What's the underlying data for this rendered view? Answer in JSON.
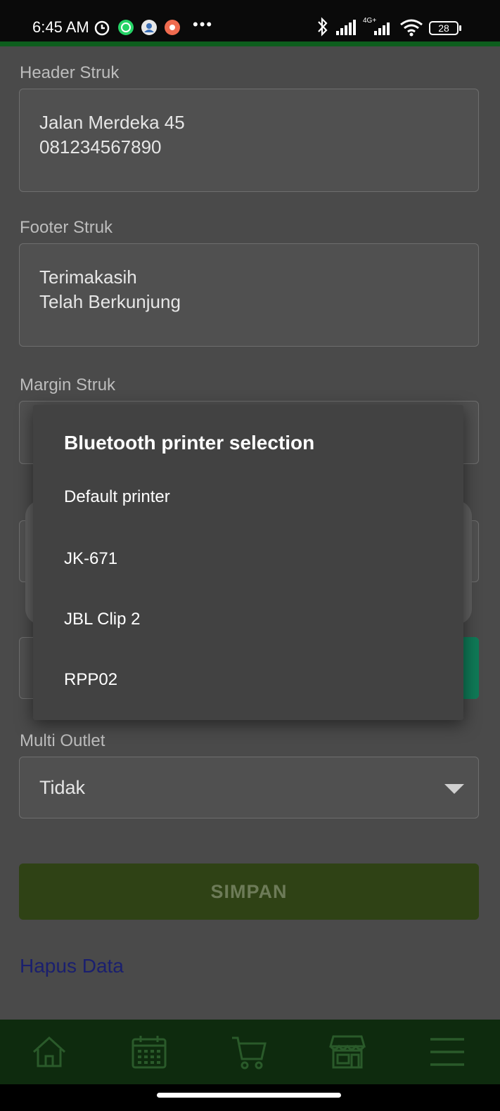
{
  "status_bar": {
    "time": "6:45 AM",
    "battery": "28",
    "network": "4G+",
    "icons": [
      "alarm-icon",
      "whatsapp-icon",
      "contacts-icon",
      "notification-app-icon",
      "bluetooth-icon",
      "signal-icon",
      "wifi-icon",
      "battery-icon"
    ]
  },
  "form": {
    "header_label": "Header Struk",
    "header_value": "Jalan Merdeka 45\n081234567890",
    "footer_label": "Footer Struk",
    "footer_value": "Terimakasih\nTelah Berkunjung",
    "margin_label": "Margin Struk",
    "multi_outlet_label": "Multi Outlet",
    "multi_outlet_value": "Tidak",
    "save_label": "SIMPAN",
    "delete_link": "Hapus Data"
  },
  "dialog": {
    "title": "Bluetooth printer selection",
    "items": [
      {
        "label": "Default printer"
      },
      {
        "label": "JK-671"
      },
      {
        "label": "JBL Clip 2"
      },
      {
        "label": "RPP02"
      }
    ]
  },
  "bottom_nav": {
    "items": [
      "home-icon",
      "calendar-icon",
      "cart-icon",
      "store-icon",
      "menu-icon"
    ]
  },
  "colors": {
    "accent_green": "#0d5e1d",
    "nav_bg": "#0e2b0e",
    "dialog_bg": "#424242",
    "link": "#1a1f6e"
  }
}
